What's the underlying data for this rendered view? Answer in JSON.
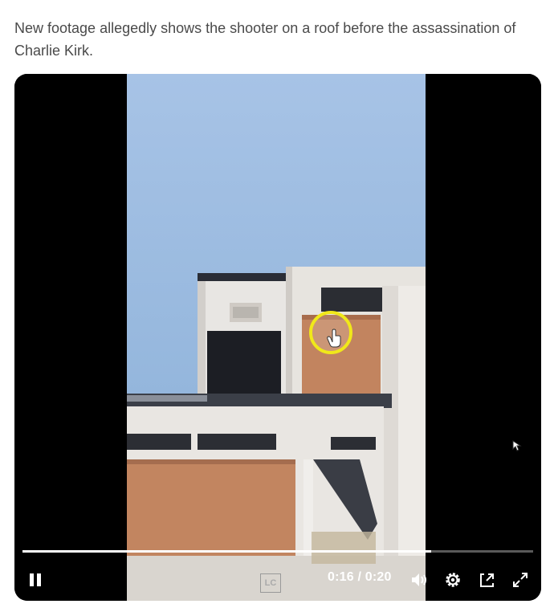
{
  "post": {
    "text": "New footage allegedly shows the shooter on a roof before the assassination of Charlie Kirk."
  },
  "video": {
    "current_time": "0:16",
    "separator": " / ",
    "duration": "0:20",
    "progress": 0.8,
    "watermark_text": "LC",
    "icons": {
      "play_pause": "pause-icon",
      "volume": "volume-muted-icon",
      "settings": "settings-gear-icon",
      "pip": "picture-in-picture-icon",
      "fullscreen": "fullscreen-icon"
    }
  },
  "colors": {
    "sky": "#8fb3d9",
    "building": "#e6e3df",
    "panel": "#c07a55",
    "cursor_ring": "#f0e81a"
  }
}
